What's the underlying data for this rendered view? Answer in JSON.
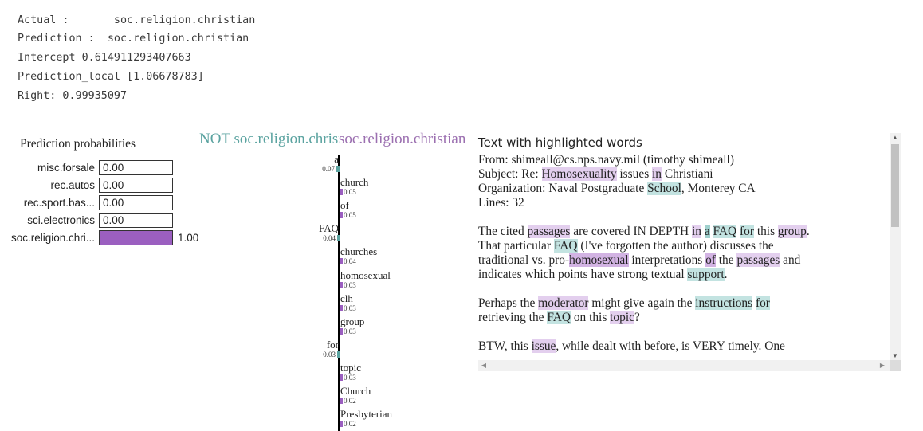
{
  "output": {
    "actual": "Actual :       soc.religion.christian",
    "prediction": "Prediction :  soc.religion.christian",
    "intercept": "Intercept 0.614911293407663",
    "prediction_local": "Prediction_local [1.06678783]",
    "right": "Right: 0.99935097"
  },
  "probabilities": {
    "title": "Prediction probabilities",
    "rows": [
      {
        "label": "misc.forsale",
        "value": "0.00",
        "fraction": 0.0
      },
      {
        "label": "rec.autos",
        "value": "0.00",
        "fraction": 0.0
      },
      {
        "label": "rec.sport.bas...",
        "value": "0.00",
        "fraction": 0.0
      },
      {
        "label": "sci.electronics",
        "value": "0.00",
        "fraction": 0.0
      },
      {
        "label": "soc.religion.chri...",
        "value": "1.00",
        "fraction": 1.0
      }
    ]
  },
  "explanation": {
    "not_label": "NOT soc.religion.christian",
    "yes_label": "soc.religion.christian",
    "features": [
      {
        "word": "a",
        "value": "0.07",
        "weight": 0.07,
        "side": "left"
      },
      {
        "word": "church",
        "value": "0.05",
        "weight": 0.05,
        "side": "right"
      },
      {
        "word": "of",
        "value": "0.05",
        "weight": 0.05,
        "side": "right"
      },
      {
        "word": "FAQ",
        "value": "0.04",
        "weight": 0.04,
        "side": "left"
      },
      {
        "word": "churches",
        "value": "0.04",
        "weight": 0.04,
        "side": "right"
      },
      {
        "word": "homosexual",
        "value": "0.03",
        "weight": 0.03,
        "side": "right"
      },
      {
        "word": "clh",
        "value": "0.03",
        "weight": 0.03,
        "side": "right"
      },
      {
        "word": "group",
        "value": "0.03",
        "weight": 0.03,
        "side": "right"
      },
      {
        "word": "for",
        "value": "0.03",
        "weight": 0.03,
        "side": "left"
      },
      {
        "word": "topic",
        "value": "0.03",
        "weight": 0.03,
        "side": "right"
      },
      {
        "word": "Church",
        "value": "0.02",
        "weight": 0.02,
        "side": "right"
      },
      {
        "word": "Presbyterian",
        "value": "0.02",
        "weight": 0.02,
        "side": "right"
      }
    ]
  },
  "text_panel": {
    "title": "Text with highlighted words",
    "from": "From: shimeall@cs.nps.navy.mil (timothy shimeall)",
    "subject_a": "Subject: Re: ",
    "subject_hl1": "Homosexuality",
    "subject_b": " issues ",
    "subject_hl2": "in",
    "subject_c": " Christiani",
    "organization": "Organization: Naval Postgraduate ",
    "organization_hl": "School",
    "organization_end": ", Monterey CA",
    "lines": "Lines: 32",
    "p2": {
      "t1": "The cited ",
      "h1": "passages",
      "t2": " are covered IN DEPTH ",
      "h2": "in",
      "t3": " ",
      "h3": "a",
      "t4": " ",
      "h4": "FAQ",
      "t5": " ",
      "h5": "for",
      "t6": " this ",
      "h6": "group",
      "t7": ".",
      "t8": "That particular ",
      "h7": "FAQ",
      "t9": " (I've forgotten the author) discusses the",
      "t10": "traditional vs. pro-",
      "h8": "homosexual",
      "t11": " interpretations ",
      "h9": "of",
      "t12": " the ",
      "h10": "passages",
      "t13": " and",
      "t14": "indicates which points have strong textual ",
      "h11": "support",
      "t15": "."
    },
    "p3": {
      "t1": "Perhaps the ",
      "h1": "moderator",
      "t2": " might give again the ",
      "h2": "instructions",
      "t3": " ",
      "h3": "for",
      "t4": "retrieving the ",
      "h4": "FAQ",
      "t5": " on this ",
      "h5": "topic",
      "t6": "?"
    },
    "p4": {
      "t1": "BTW, this ",
      "h1": "issue",
      "t2": ", while dealt with before, is VERY timely.  One"
    }
  },
  "colors": {
    "positive": "#9b5fc0",
    "negative": "#5ba3a0"
  }
}
